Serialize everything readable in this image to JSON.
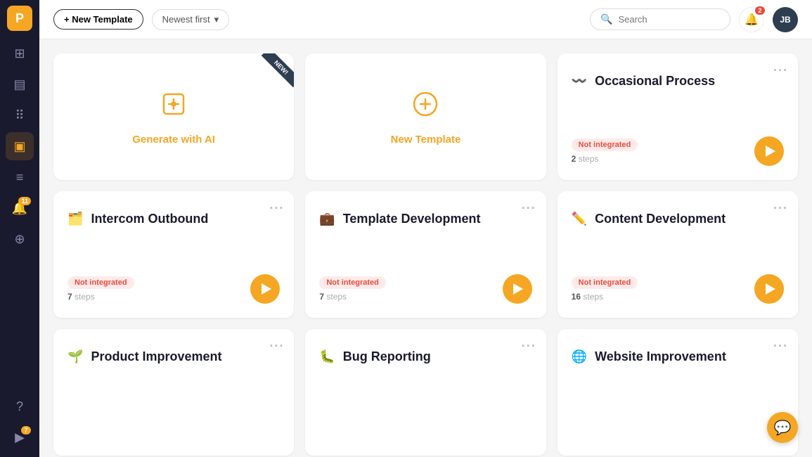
{
  "sidebar": {
    "logo_text": "P",
    "items": [
      {
        "id": "dashboard",
        "icon": "⊞",
        "active": false
      },
      {
        "id": "grid",
        "icon": "▤",
        "active": false
      },
      {
        "id": "apps",
        "icon": "⠿",
        "active": false
      },
      {
        "id": "templates",
        "icon": "▣",
        "active": true
      },
      {
        "id": "list",
        "icon": "≡",
        "active": false
      },
      {
        "id": "notifications",
        "icon": "🔔",
        "badge": "11",
        "active": false
      },
      {
        "id": "integrations",
        "icon": "⊕",
        "active": false
      },
      {
        "id": "help",
        "icon": "?",
        "active": false
      },
      {
        "id": "play",
        "icon": "▶",
        "active": false,
        "badge": "7"
      }
    ]
  },
  "header": {
    "new_template_label": "+ New Template",
    "sort_label": "Newest first",
    "search_placeholder": "Search",
    "notification_badge": "2",
    "avatar_text": "JB"
  },
  "cards": [
    {
      "id": "generate-ai",
      "type": "generate",
      "icon": "⊕",
      "label": "Generate with AI",
      "has_new_badge": true
    },
    {
      "id": "new-template",
      "type": "new-template",
      "icon": "⊕",
      "label": "New Template"
    },
    {
      "id": "occasional-process",
      "type": "regular",
      "emoji": "〰️",
      "title": "Occasional Process",
      "not_integrated": true,
      "not_integrated_label": "Not integrated",
      "steps": 2,
      "steps_label": "steps"
    },
    {
      "id": "intercom-outbound",
      "type": "regular",
      "emoji": "🗂️",
      "title": "Intercom Outbound",
      "not_integrated": true,
      "not_integrated_label": "Not integrated",
      "steps": 7,
      "steps_label": "steps"
    },
    {
      "id": "template-development",
      "type": "regular",
      "emoji": "💼",
      "title": "Template Development",
      "not_integrated": true,
      "not_integrated_label": "Not integrated",
      "steps": 7,
      "steps_label": "steps"
    },
    {
      "id": "content-development",
      "type": "regular",
      "emoji": "✏️",
      "title": "Content Development",
      "not_integrated": true,
      "not_integrated_label": "Not integrated",
      "steps": 16,
      "steps_label": "steps"
    },
    {
      "id": "product-improvement",
      "type": "regular",
      "emoji": "🌱",
      "title": "Product Improvement",
      "not_integrated": false,
      "steps": null,
      "steps_label": ""
    },
    {
      "id": "bug-reporting",
      "type": "regular",
      "emoji": "🐛",
      "title": "Bug Reporting",
      "not_integrated": false,
      "steps": null,
      "steps_label": ""
    },
    {
      "id": "website-improvement",
      "type": "regular",
      "emoji": "🌐",
      "title": "Website Improvement",
      "not_integrated": false,
      "steps": null,
      "steps_label": ""
    }
  ],
  "chat_icon": "💬"
}
